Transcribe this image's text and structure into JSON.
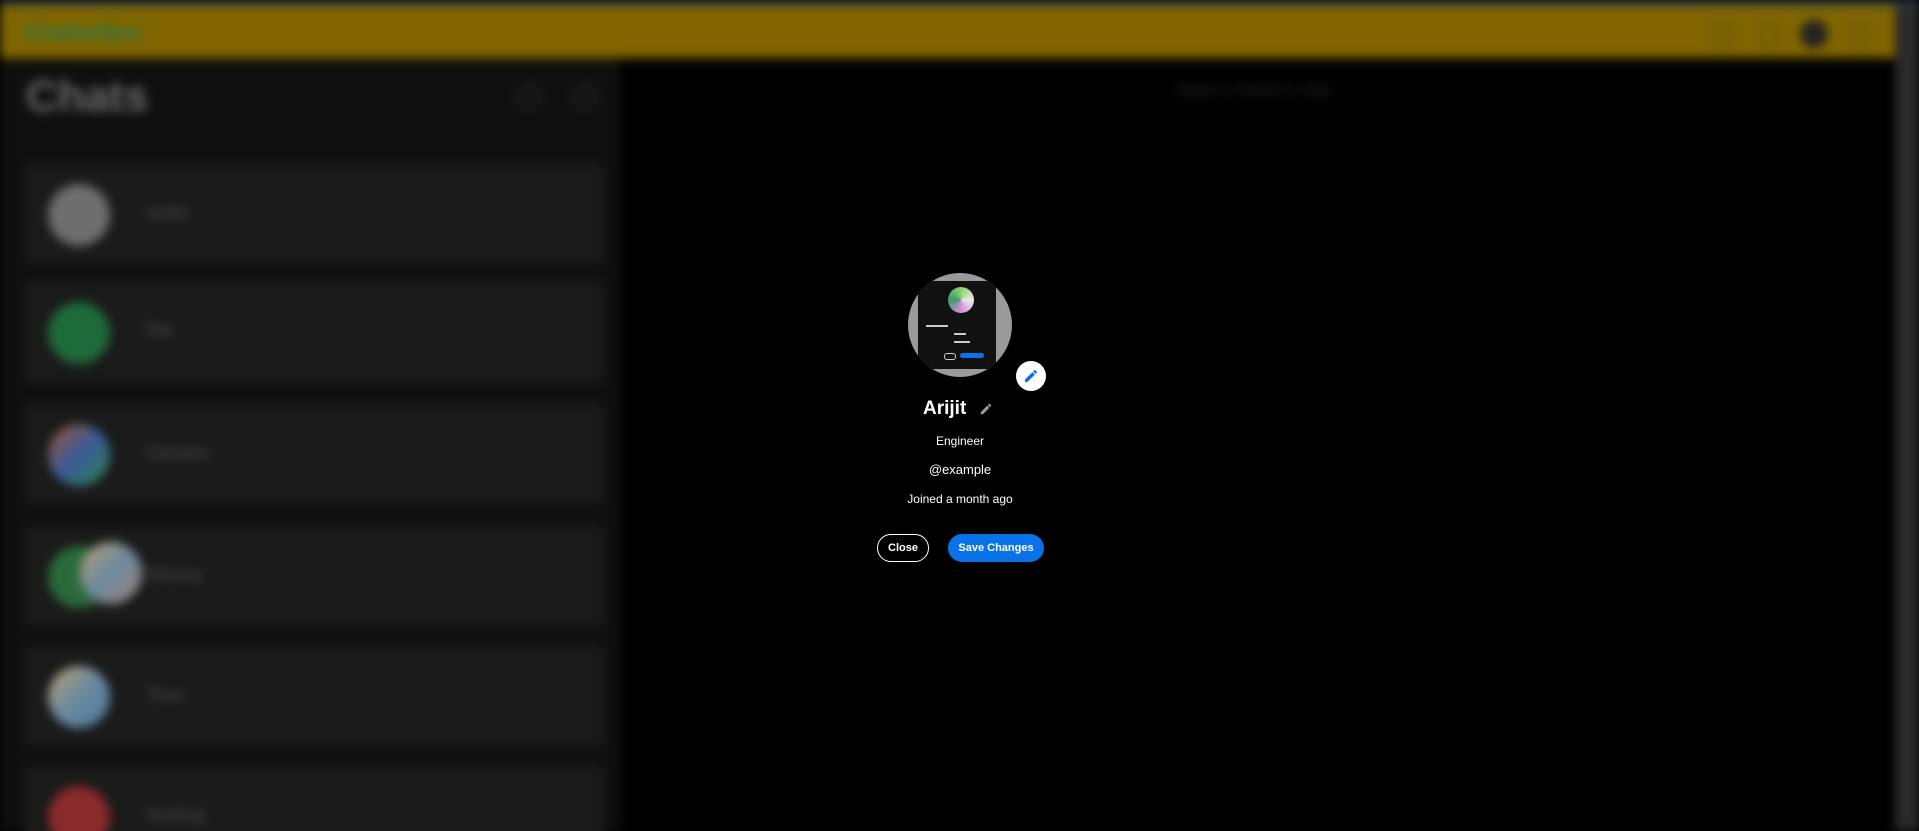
{
  "app": {
    "brand": "ChatterBox",
    "sidebar_title": "Chats",
    "chats": [
      {
        "name": "ankit",
        "avatar_color": "#6e6e6e"
      },
      {
        "name": "fifa",
        "avatar_color": "#1e6b3a"
      },
      {
        "name": "Daniau",
        "avatar_color": "#3a5a9a"
      },
      {
        "name": "Messy",
        "avatar_color": "#7a8a5a"
      },
      {
        "name": "Tour",
        "avatar_color": "#6a8aa0"
      },
      {
        "name": "testing",
        "avatar_color": "#8a2a2a"
      }
    ],
    "right_hint": "Select a friend to chat"
  },
  "profile_modal": {
    "name": "Arijit",
    "bio": "Engineer",
    "username": "@example",
    "joined": "Joined a month ago",
    "close_label": "Close",
    "save_label": "Save Changes",
    "icons": {
      "avatar_edit": "pencil-icon",
      "name_edit": "pencil-icon"
    }
  },
  "colors": {
    "navbar": "#806500",
    "accent": "#0a72e8",
    "backdrop": "#000000"
  }
}
